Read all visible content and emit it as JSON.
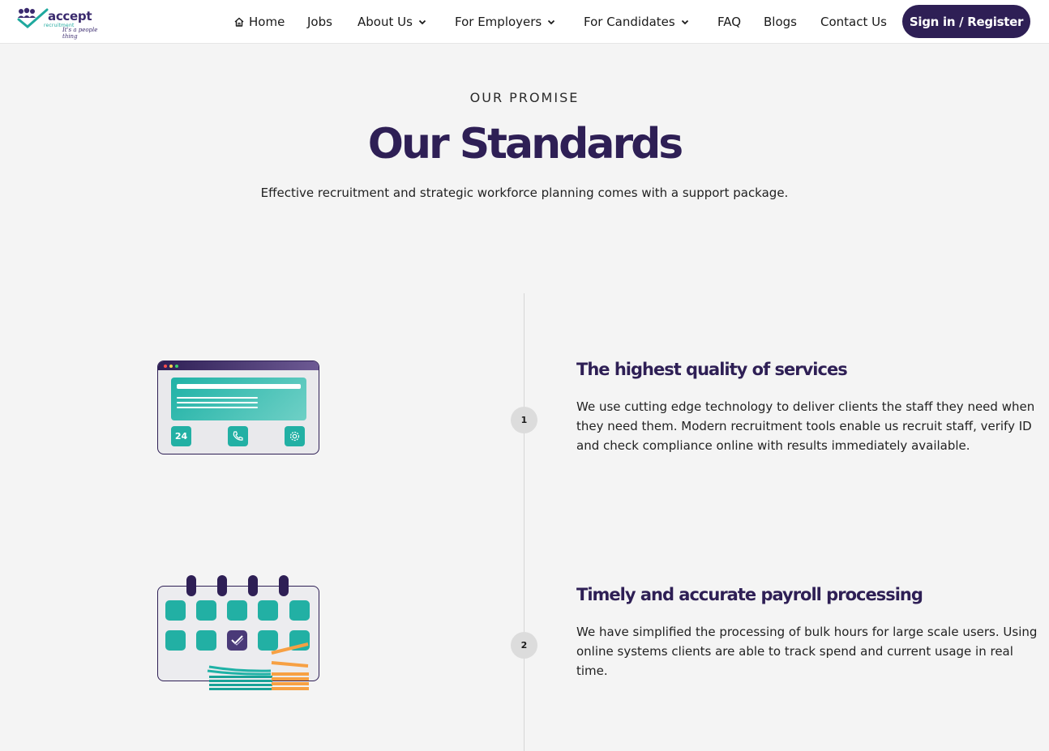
{
  "header": {
    "logo": {
      "name": "accept",
      "sub": "recruitment",
      "tagline": "It's a people thing"
    },
    "nav": [
      {
        "label": "Home",
        "icon": "home-icon"
      },
      {
        "label": "Jobs"
      },
      {
        "label": "About Us",
        "dropdown": true
      },
      {
        "label": "For Employers",
        "dropdown": true
      },
      {
        "label": "For Candidates",
        "dropdown": true
      },
      {
        "label": "FAQ"
      },
      {
        "label": "Blogs"
      },
      {
        "label": "Contact Us"
      }
    ],
    "cta_label": "Sign in / Register"
  },
  "hero": {
    "eyebrow": "OUR PROMISE",
    "title": "Our Standards",
    "subtitle": "Effective recruitment and strategic workforce planning comes with a support package."
  },
  "features": [
    {
      "number": "1",
      "title": "The highest quality of services",
      "body": "We use cutting edge technology to deliver clients the staff they need when they need them. Modern recruitment tools enable us recruit staff, verify ID and check compliance online with results immediately available.",
      "tile_label": "24"
    },
    {
      "number": "2",
      "title": "Timely and accurate payroll processing",
      "body": "We have simplified the processing of bulk hours for large scale users. Using online systems clients are able to track spend and current usage in real time."
    }
  ],
  "colors": {
    "brand_purple": "#2e1f55",
    "teal": "#22b0a4",
    "orange": "#f7a043",
    "background": "#f4f4f4"
  }
}
